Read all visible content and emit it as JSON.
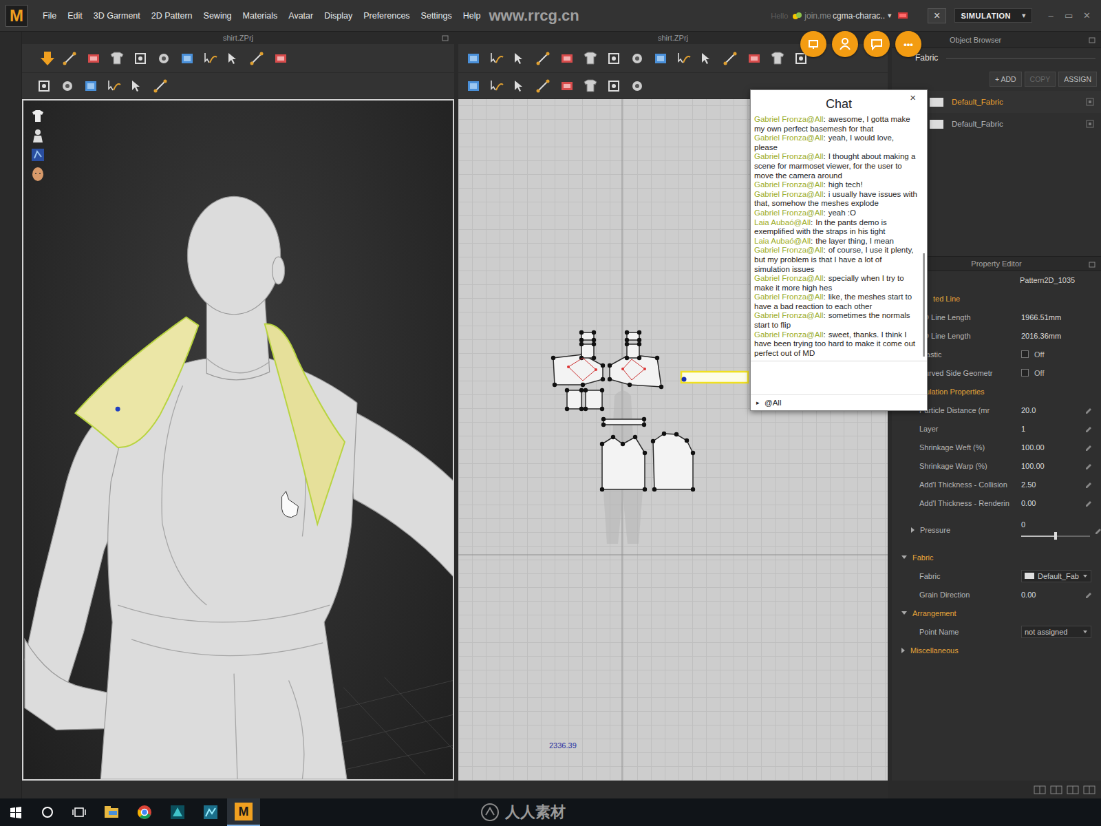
{
  "menubar": {
    "logo": "M",
    "items": [
      "File",
      "Edit",
      "3D Garment",
      "2D Pattern",
      "Sewing",
      "Materials",
      "Avatar",
      "Display",
      "Preferences",
      "Settings",
      "Help"
    ],
    "watermark": "www.rrcg.cn",
    "hello": "Hello",
    "joinme": "join.me",
    "session": "cgma-charac..",
    "session_arrow": "▾",
    "close": "×",
    "mode": "SIMULATION",
    "mode_arrow": "▾",
    "window_controls": [
      "–",
      "▭",
      "✕"
    ]
  },
  "quick_more": "•••",
  "viewports": {
    "garment_3d": {
      "title": "shirt.ZPrj"
    },
    "pattern_2d": {
      "title": "shirt.ZPrj",
      "coordinate": "2336.39"
    }
  },
  "chat": {
    "title": "Chat",
    "close": "×",
    "separator": ":",
    "messages": [
      {
        "author": "Gabriel Fronza@All",
        "text": "awesome, I gotta make my own perfect basemesh for that"
      },
      {
        "author": "Gabriel Fronza@All",
        "text": "yeah, I would love, please"
      },
      {
        "author": "Gabriel Fronza@All",
        "text": "I thought about making a scene for marmoset viewer, for the user to move the camera around"
      },
      {
        "author": "Gabriel Fronza@All",
        "text": "high tech!"
      },
      {
        "author": "Gabriel Fronza@All",
        "text": "i usually have issues with that, somehow the meshes explode"
      },
      {
        "author": "Gabriel Fronza@All",
        "text": "yeah :O"
      },
      {
        "author": "Laia Aubaó@All",
        "text": "In the pants demo is exemplified with the straps in his tight"
      },
      {
        "author": "Laia Aubaó@All",
        "text": "the layer thing, I mean"
      },
      {
        "author": "Gabriel Fronza@All",
        "text": "of course, I use it plenty, but my problem is that I have a lot of simulation issues"
      },
      {
        "author": "Gabriel Fronza@All",
        "text": "specially when I try to make it more high hes"
      },
      {
        "author": "Gabriel Fronza@All",
        "text": "like, the meshes start to have a bad reaction to each other"
      },
      {
        "author": "Gabriel Fronza@All",
        "text": "sometimes the normals start to flip"
      },
      {
        "author": "Gabriel Fronza@All",
        "text": "sweet, thanks. I think I have been trying too hard to make it come out perfect out of MD"
      }
    ],
    "recipient_arrow": "▸",
    "recipient": "@All"
  },
  "object_browser": {
    "title": "Object Browser",
    "tab": "Fabric",
    "buttons": [
      {
        "label": "+ ADD",
        "disabled": false
      },
      {
        "label": "COPY",
        "disabled": true
      },
      {
        "label": "ASSIGN",
        "disabled": false
      }
    ],
    "items": [
      {
        "label": "Default_Fabric",
        "selected": true
      },
      {
        "label": "Default_Fabric",
        "selected": false
      }
    ]
  },
  "property_editor": {
    "title": "Property Editor",
    "object": "Pattern2D_1035",
    "sections": [
      {
        "label": "ted Line",
        "expanded": true,
        "rows": [
          {
            "kind": "value",
            "label": "2D Line Length",
            "value": "1966.51mm",
            "editable": false
          },
          {
            "kind": "value",
            "label": "3D Line Length",
            "value": "2016.36mm",
            "editable": false
          },
          {
            "kind": "toggle",
            "label": "Elastic",
            "value": "Off",
            "checked": false
          },
          {
            "kind": "toggle",
            "label": "Curved Side Geometr",
            "value": "Off",
            "checked": false
          }
        ]
      },
      {
        "label": "Simulation Properties",
        "expanded": true,
        "rows": [
          {
            "kind": "value",
            "label": "Particle Distance (mr",
            "value": "20.0",
            "editable": true
          },
          {
            "kind": "value",
            "label": "Layer",
            "value": "1",
            "editable": true
          },
          {
            "kind": "value",
            "label": "Shrinkage Weft (%)",
            "value": "100.00",
            "editable": true
          },
          {
            "kind": "value",
            "label": "Shrinkage Warp (%)",
            "value": "100.00",
            "editable": true
          },
          {
            "kind": "value",
            "label": "Add'l Thickness - Collision",
            "value": "2.50",
            "editable": true
          },
          {
            "kind": "value",
            "label": "Add'l Thickness - Renderin",
            "value": "0.00",
            "editable": true
          },
          {
            "kind": "slider",
            "label": "Pressure",
            "value": "0",
            "editable": true,
            "expanded": false,
            "level": 0.5
          }
        ]
      },
      {
        "label": "Fabric",
        "expanded": true,
        "rows": [
          {
            "kind": "dropdown",
            "label": "Fabric",
            "value": "Default_Fab",
            "swatch": true
          },
          {
            "kind": "value",
            "label": "Grain Direction",
            "value": "0.00",
            "editable": true
          }
        ]
      },
      {
        "label": "Arrangement",
        "expanded": true,
        "rows": [
          {
            "kind": "dropdown",
            "label": "Point Name",
            "value": "not assigned",
            "swatch": false
          }
        ]
      },
      {
        "label": "Miscellaneous",
        "expanded": false,
        "rows": []
      }
    ]
  },
  "taskbar": {
    "active_app": "M",
    "watermark": "人人素材"
  }
}
